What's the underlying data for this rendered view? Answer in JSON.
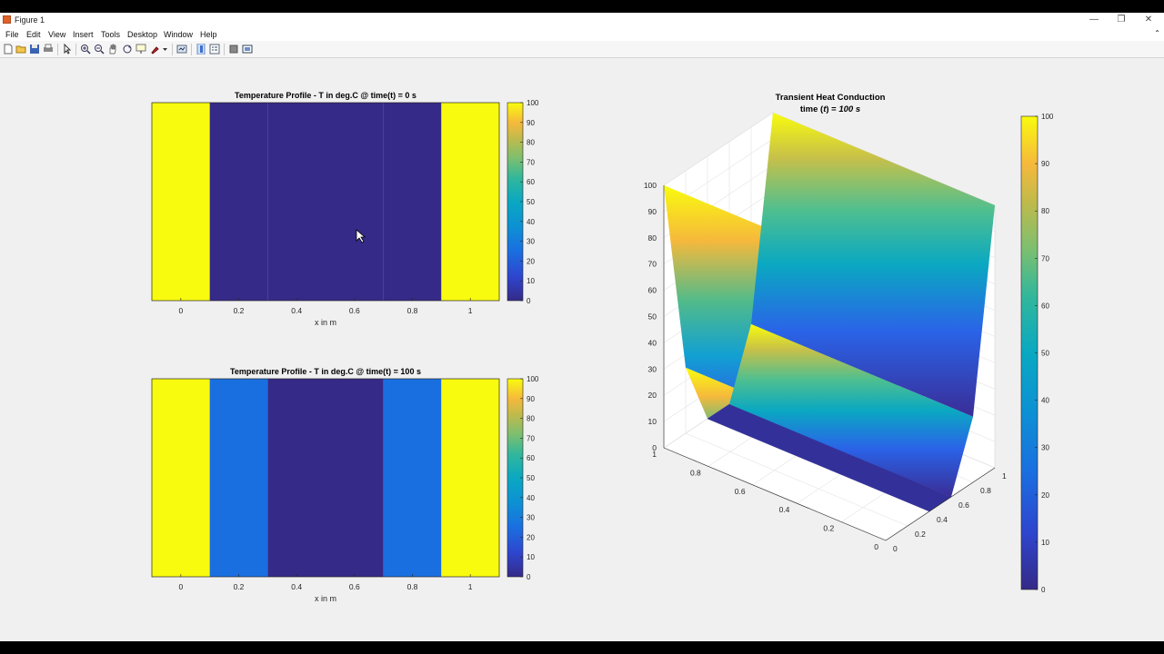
{
  "window": {
    "title": "Figure 1",
    "controls": {
      "minimize": "—",
      "restore": "❐",
      "close": "✕"
    }
  },
  "menubar": {
    "items": [
      "File",
      "Edit",
      "View",
      "Insert",
      "Tools",
      "Desktop",
      "Window",
      "Help"
    ],
    "arrow": "⌃"
  },
  "toolbar": {
    "buttons": [
      "new-figure-icon",
      "open-file-icon",
      "save-icon",
      "print-icon",
      "select-arrow-icon",
      "zoom-in-icon",
      "zoom-out-icon",
      "pan-hand-icon",
      "rotate-3d-icon",
      "data-cursor-icon",
      "brush-icon",
      "brush-dropdown-icon",
      "link-plot-icon",
      "insert-colorbar-icon",
      "insert-legend-icon",
      "hide-plot-tools-icon",
      "show-plot-tools-icon"
    ]
  },
  "colors": {
    "parula_low": "#352a87",
    "parula_high": "#f9fb0e",
    "blue_band": "#2c6ff7",
    "window_bg": "#f0f0f0"
  },
  "chart_data": [
    {
      "type": "heatmap",
      "title": "Temperature Profile - T in deg.C @ time(t) = 0 s",
      "xlabel": "x in m",
      "ylabel": "",
      "xlim": [
        -0.1,
        1.1
      ],
      "x_ticks": [
        0,
        0.2,
        0.4,
        0.6,
        0.8,
        1
      ],
      "x_tick_labels": [
        "0",
        "0.2",
        "0.4",
        "0.6",
        "0.8",
        "1"
      ],
      "cells_x": [
        0,
        0.2,
        0.4,
        0.6,
        0.8,
        1
      ],
      "values": [
        100,
        0,
        0,
        0,
        0,
        100
      ],
      "colorbar": {
        "limits": [
          0,
          100
        ],
        "ticks": [
          "0",
          "10",
          "20",
          "30",
          "40",
          "50",
          "60",
          "70",
          "80",
          "90",
          "100"
        ]
      }
    },
    {
      "type": "heatmap",
      "title": "Temperature Profile - T in deg.C @ time(t) = 100 s",
      "xlabel": "x in m",
      "ylabel": "",
      "xlim": [
        -0.1,
        1.1
      ],
      "x_ticks": [
        0,
        0.2,
        0.4,
        0.6,
        0.8,
        1
      ],
      "x_tick_labels": [
        "0",
        "0.2",
        "0.4",
        "0.6",
        "0.8",
        "1"
      ],
      "cells_x": [
        0,
        0.2,
        0.4,
        0.6,
        0.8,
        1
      ],
      "values": [
        100,
        25,
        0,
        0,
        25,
        100
      ],
      "colorbar": {
        "limits": [
          0,
          100
        ],
        "ticks": [
          "0",
          "10",
          "20",
          "30",
          "40",
          "50",
          "60",
          "70",
          "80",
          "90",
          "100"
        ]
      }
    },
    {
      "type": "surface",
      "title_line1": "Transient Heat Conduction",
      "title_line2_prefix": "time (",
      "title_line2_var": "t",
      "title_line2_mid": ") = ",
      "title_line2_value": "100 s",
      "x": [
        0,
        0.2,
        0.4,
        0.6,
        0.8,
        1
      ],
      "y": [
        0,
        0.2,
        0.4,
        0.6,
        0.8,
        1
      ],
      "z_profile": [
        100,
        25,
        0,
        0,
        25,
        100
      ],
      "zlim": [
        0,
        100
      ],
      "z_ticks": [
        "0",
        "10",
        "20",
        "30",
        "40",
        "50",
        "60",
        "70",
        "80",
        "90",
        "100"
      ],
      "x_tick_labels": [
        "0",
        "0.2",
        "0.4",
        "0.6",
        "0.8",
        "1"
      ],
      "y_tick_labels": [
        "0",
        "0.2",
        "0.4",
        "0.6",
        "0.8",
        "1"
      ],
      "colorbar": {
        "limits": [
          0,
          100
        ],
        "ticks": [
          "0",
          "10",
          "20",
          "30",
          "40",
          "50",
          "60",
          "70",
          "80",
          "90",
          "100"
        ]
      }
    }
  ]
}
